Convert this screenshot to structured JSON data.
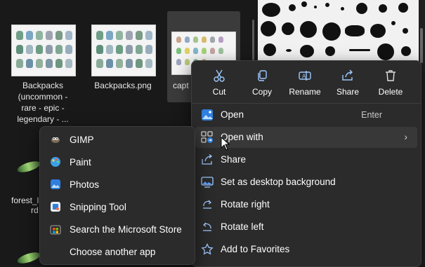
{
  "files": [
    {
      "name": "Backpacks (uncommon - rare - epic - legendary - ..."
    },
    {
      "name": "Backpacks.png"
    },
    {
      "name": "capt"
    },
    {
      "name": "forest_l"
    },
    {
      "name": "rd"
    }
  ],
  "context_menu": {
    "quick_actions": [
      {
        "label": "Cut",
        "icon": "scissors-icon"
      },
      {
        "label": "Copy",
        "icon": "copy-icon"
      },
      {
        "label": "Rename",
        "icon": "rename-icon"
      },
      {
        "label": "Share",
        "icon": "share-icon"
      },
      {
        "label": "Delete",
        "icon": "trash-icon"
      }
    ],
    "items": [
      {
        "label": "Open",
        "shortcut": "Enter",
        "icon": "image-icon"
      },
      {
        "label": "Open with",
        "icon": "open-with-icon",
        "chevron": "›"
      },
      {
        "label": "Share",
        "icon": "share-icon"
      },
      {
        "label": "Set as desktop background",
        "icon": "desktop-icon"
      },
      {
        "label": "Rotate right",
        "icon": "rotate-right-icon"
      },
      {
        "label": "Rotate left",
        "icon": "rotate-left-icon"
      },
      {
        "label": "Add to Favorites",
        "icon": "star-icon"
      }
    ]
  },
  "open_with_submenu": {
    "items": [
      {
        "label": "GIMP",
        "icon": "gimp-icon"
      },
      {
        "label": "Paint",
        "icon": "paint-icon"
      },
      {
        "label": "Photos",
        "icon": "photos-icon"
      },
      {
        "label": "Snipping Tool",
        "icon": "snipping-tool-icon"
      },
      {
        "label": "Search the Microsoft Store",
        "icon": "microsoft-store-icon"
      },
      {
        "label": "Choose another app",
        "icon": ""
      }
    ]
  },
  "colors": {
    "menu_bg": "#2b2b2b",
    "hover_bg": "#383838",
    "accent": "#4aa3ff"
  }
}
